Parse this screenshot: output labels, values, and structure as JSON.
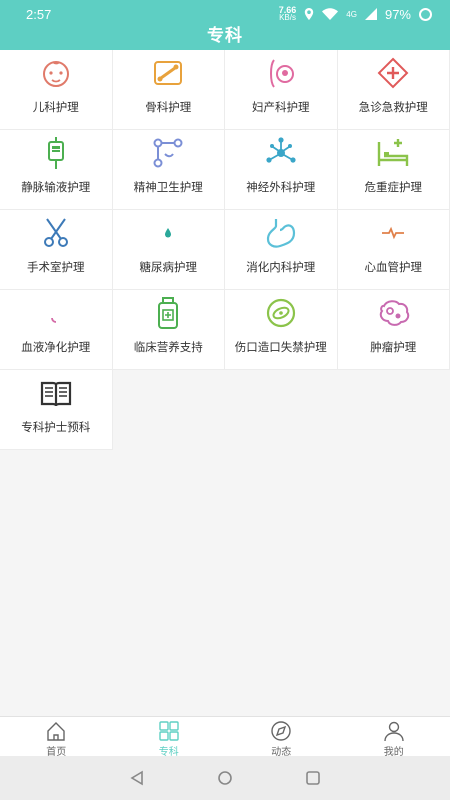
{
  "status_bar": {
    "time": "2:57",
    "net_speed": "7.66",
    "net_unit": "KB/s",
    "signal": "4G",
    "battery": "97%"
  },
  "header": {
    "title": "专科"
  },
  "categories": [
    {
      "label": "儿科护理",
      "icon": "baby-face-icon",
      "color": "#e07a6a"
    },
    {
      "label": "骨科护理",
      "icon": "bone-icon",
      "color": "#e8a23c"
    },
    {
      "label": "妇产科护理",
      "icon": "pregnant-icon",
      "color": "#e06aa0"
    },
    {
      "label": "急诊急救护理",
      "icon": "emergency-cross-icon",
      "color": "#e05a5a"
    },
    {
      "label": "静脉输液护理",
      "icon": "iv-drip-icon",
      "color": "#4caf50"
    },
    {
      "label": "精神卫生护理",
      "icon": "mental-health-icon",
      "color": "#7b8fd6"
    },
    {
      "label": "神经外科护理",
      "icon": "neuron-icon",
      "color": "#3aa6c8"
    },
    {
      "label": "危重症护理",
      "icon": "hospital-bed-icon",
      "color": "#8bc34a"
    },
    {
      "label": "手术室护理",
      "icon": "scissors-icon",
      "color": "#3d7ab8"
    },
    {
      "label": "糖尿病护理",
      "icon": "heart-drop-icon",
      "color": "#2aa89a"
    },
    {
      "label": "消化内科护理",
      "icon": "stomach-icon",
      "color": "#5bc0d8"
    },
    {
      "label": "心血管护理",
      "icon": "heart-pulse-icon",
      "color": "#e0804a"
    },
    {
      "label": "血液净化护理",
      "icon": "blood-drop-icon",
      "color": "#d46aa6"
    },
    {
      "label": "临床营养支持",
      "icon": "nutrition-bottle-icon",
      "color": "#4caf50"
    },
    {
      "label": "伤口造口失禁护理",
      "icon": "wound-icon",
      "color": "#8bc34a"
    },
    {
      "label": "肿瘤护理",
      "icon": "tumor-icon",
      "color": "#c86ab0"
    },
    {
      "label": "专科护士预科",
      "icon": "open-book-icon",
      "color": "#333333"
    }
  ],
  "tabbar": [
    {
      "label": "首页",
      "icon": "home-icon",
      "active": false
    },
    {
      "label": "专科",
      "icon": "grid-icon",
      "active": true
    },
    {
      "label": "动态",
      "icon": "compass-icon",
      "active": false
    },
    {
      "label": "我的",
      "icon": "person-icon",
      "active": false
    }
  ],
  "colors": {
    "accent": "#5ecfc3",
    "tab_inactive": "#666666"
  }
}
